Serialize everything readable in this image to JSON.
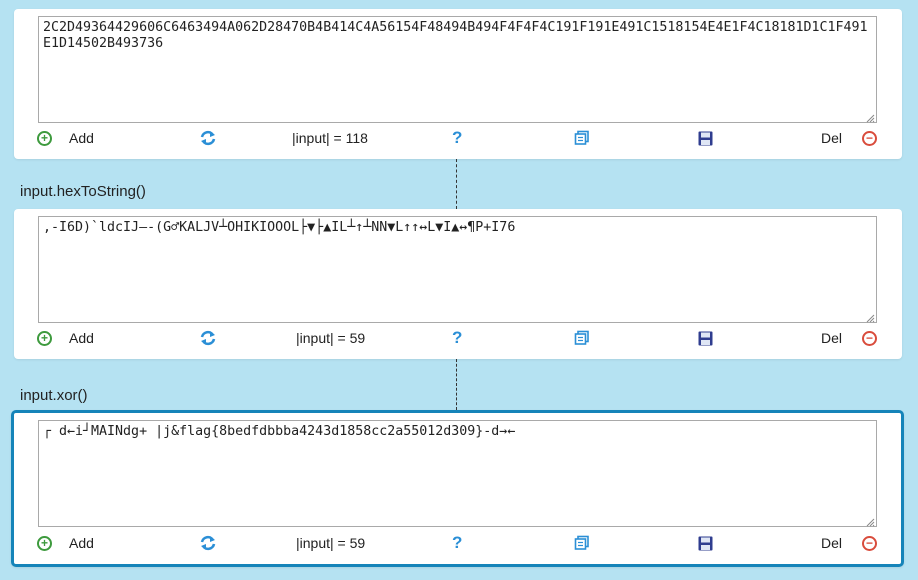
{
  "panels": [
    {
      "text": "2C2D49364429606C6463494A062D28470B4B414C4A56154F48494B494F4F4F4C191F191E491C1518154E4E1F4C18181D1C1F491E1D14502B493736",
      "add_label": "Add",
      "length_label": "|input| = 118",
      "help_label": "?",
      "del_label": "Del"
    },
    {
      "text": ",-I6D)`ldcIJ–-(G♂KALJV┴OHIKIOOOL├▼├▲IL┴↑┴NN▼L↑↑↔L▼I▲↔¶P+I76",
      "add_label": "Add",
      "length_label": "|input| = 59",
      "help_label": "?",
      "del_label": "Del"
    },
    {
      "text": "┌ d←i┘MAINdg+ |j&flag{8bedfdbbba4243d1858cc2a55012d309}-d→←",
      "add_label": "Add",
      "length_label": "|input| = 59",
      "help_label": "?",
      "del_label": "Del"
    }
  ],
  "operations": [
    "input.hexToString()",
    "input.xor()"
  ],
  "icons": {
    "add": "plus-circle-icon",
    "swap": "refresh-arrows-icon",
    "help": "question-icon",
    "copy": "copy-icon",
    "save": "floppy-disk-icon",
    "delete": "minus-circle-icon"
  },
  "colors": {
    "background": "#b5e2f2",
    "active_border": "#1584b9",
    "add_green": "#3d9a3d",
    "delete_red": "#d94c3c",
    "icon_blue": "#2b8fd6",
    "save_navy": "#2f3d8f"
  }
}
